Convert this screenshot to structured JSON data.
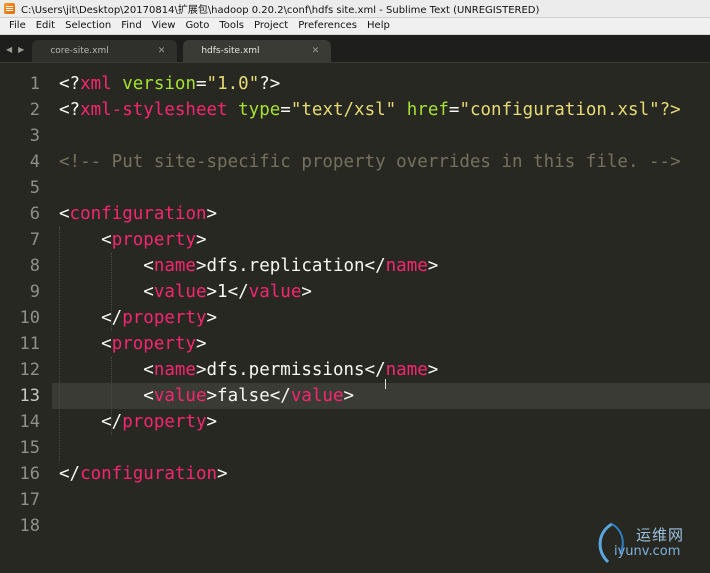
{
  "window": {
    "title": "C:\\Users\\jit\\Desktop\\20170814\\扩展包\\hadoop 0.20.2\\conf\\hdfs site.xml - Sublime Text (UNREGISTERED)"
  },
  "menu": [
    "File",
    "Edit",
    "Selection",
    "Find",
    "View",
    "Goto",
    "Tools",
    "Project",
    "Preferences",
    "Help"
  ],
  "tabs": [
    {
      "label": "core-site.xml",
      "active": false
    },
    {
      "label": "hdfs-site.xml",
      "active": true
    }
  ],
  "editor": {
    "current_line": 13,
    "line_numbers": [
      "1",
      "2",
      "3",
      "4",
      "5",
      "6",
      "7",
      "8",
      "9",
      "10",
      "11",
      "12",
      "13",
      "14",
      "15",
      "16",
      "17",
      "18"
    ],
    "lines": [
      [
        {
          "t": "<?",
          "c": "p"
        },
        {
          "t": "xml",
          "c": "tag"
        },
        {
          "t": " ",
          "c": "p"
        },
        {
          "t": "version",
          "c": "attr"
        },
        {
          "t": "=",
          "c": "p"
        },
        {
          "t": "\"1.0\"",
          "c": "str"
        },
        {
          "t": "?>",
          "c": "p"
        }
      ],
      [
        {
          "t": "<?",
          "c": "p"
        },
        {
          "t": "xml-stylesheet",
          "c": "tag"
        },
        {
          "t": " ",
          "c": "p"
        },
        {
          "t": "type",
          "c": "attr"
        },
        {
          "t": "=",
          "c": "p"
        },
        {
          "t": "\"text/xsl\"",
          "c": "str"
        },
        {
          "t": " ",
          "c": "p"
        },
        {
          "t": "href",
          "c": "attr"
        },
        {
          "t": "=",
          "c": "p"
        },
        {
          "t": "\"configuration.xsl\"?>",
          "c": "str"
        }
      ],
      [],
      [
        {
          "t": "<!-- Put site-specific property overrides in this file. -->",
          "c": "com"
        }
      ],
      [],
      [
        {
          "t": "<",
          "c": "p"
        },
        {
          "t": "configuration",
          "c": "tag"
        },
        {
          "t": ">",
          "c": "p"
        }
      ],
      [
        {
          "t": "    <",
          "c": "p"
        },
        {
          "t": "property",
          "c": "tag"
        },
        {
          "t": ">",
          "c": "p"
        }
      ],
      [
        {
          "t": "        <",
          "c": "p"
        },
        {
          "t": "name",
          "c": "tag"
        },
        {
          "t": ">dfs.replication</",
          "c": "p"
        },
        {
          "t": "name",
          "c": "tag"
        },
        {
          "t": ">",
          "c": "p"
        }
      ],
      [
        {
          "t": "        <",
          "c": "p"
        },
        {
          "t": "value",
          "c": "tag"
        },
        {
          "t": ">1</",
          "c": "p"
        },
        {
          "t": "value",
          "c": "tag"
        },
        {
          "t": ">",
          "c": "p"
        }
      ],
      [
        {
          "t": "    </",
          "c": "p"
        },
        {
          "t": "property",
          "c": "tag"
        },
        {
          "t": ">",
          "c": "p"
        }
      ],
      [
        {
          "t": "    <",
          "c": "p"
        },
        {
          "t": "property",
          "c": "tag"
        },
        {
          "t": ">",
          "c": "p"
        }
      ],
      [
        {
          "t": "        <",
          "c": "p"
        },
        {
          "t": "name",
          "c": "tag"
        },
        {
          "t": ">dfs.permissions</",
          "c": "p"
        },
        {
          "t": "name",
          "c": "tag"
        },
        {
          "t": ">",
          "c": "p"
        }
      ],
      [
        {
          "t": "        <",
          "c": "p"
        },
        {
          "t": "value",
          "c": "tag"
        },
        {
          "t": ">false</",
          "c": "p"
        },
        {
          "t": "value",
          "c": "tag"
        },
        {
          "t": ">",
          "c": "p"
        }
      ],
      [
        {
          "t": "    </",
          "c": "p"
        },
        {
          "t": "property",
          "c": "tag"
        },
        {
          "t": ">",
          "c": "p"
        }
      ],
      [],
      [
        {
          "t": "</",
          "c": "p"
        },
        {
          "t": "configuration",
          "c": "tag"
        },
        {
          "t": ">",
          "c": "p"
        }
      ],
      [],
      []
    ]
  },
  "watermark": {
    "name": "运维网",
    "url": "iyunv.com"
  },
  "colors": {
    "background": "#272822",
    "tag": "#f92672",
    "attribute": "#a6e22e",
    "string": "#e6db74",
    "comment": "#75715e",
    "text": "#f8f8f2"
  }
}
